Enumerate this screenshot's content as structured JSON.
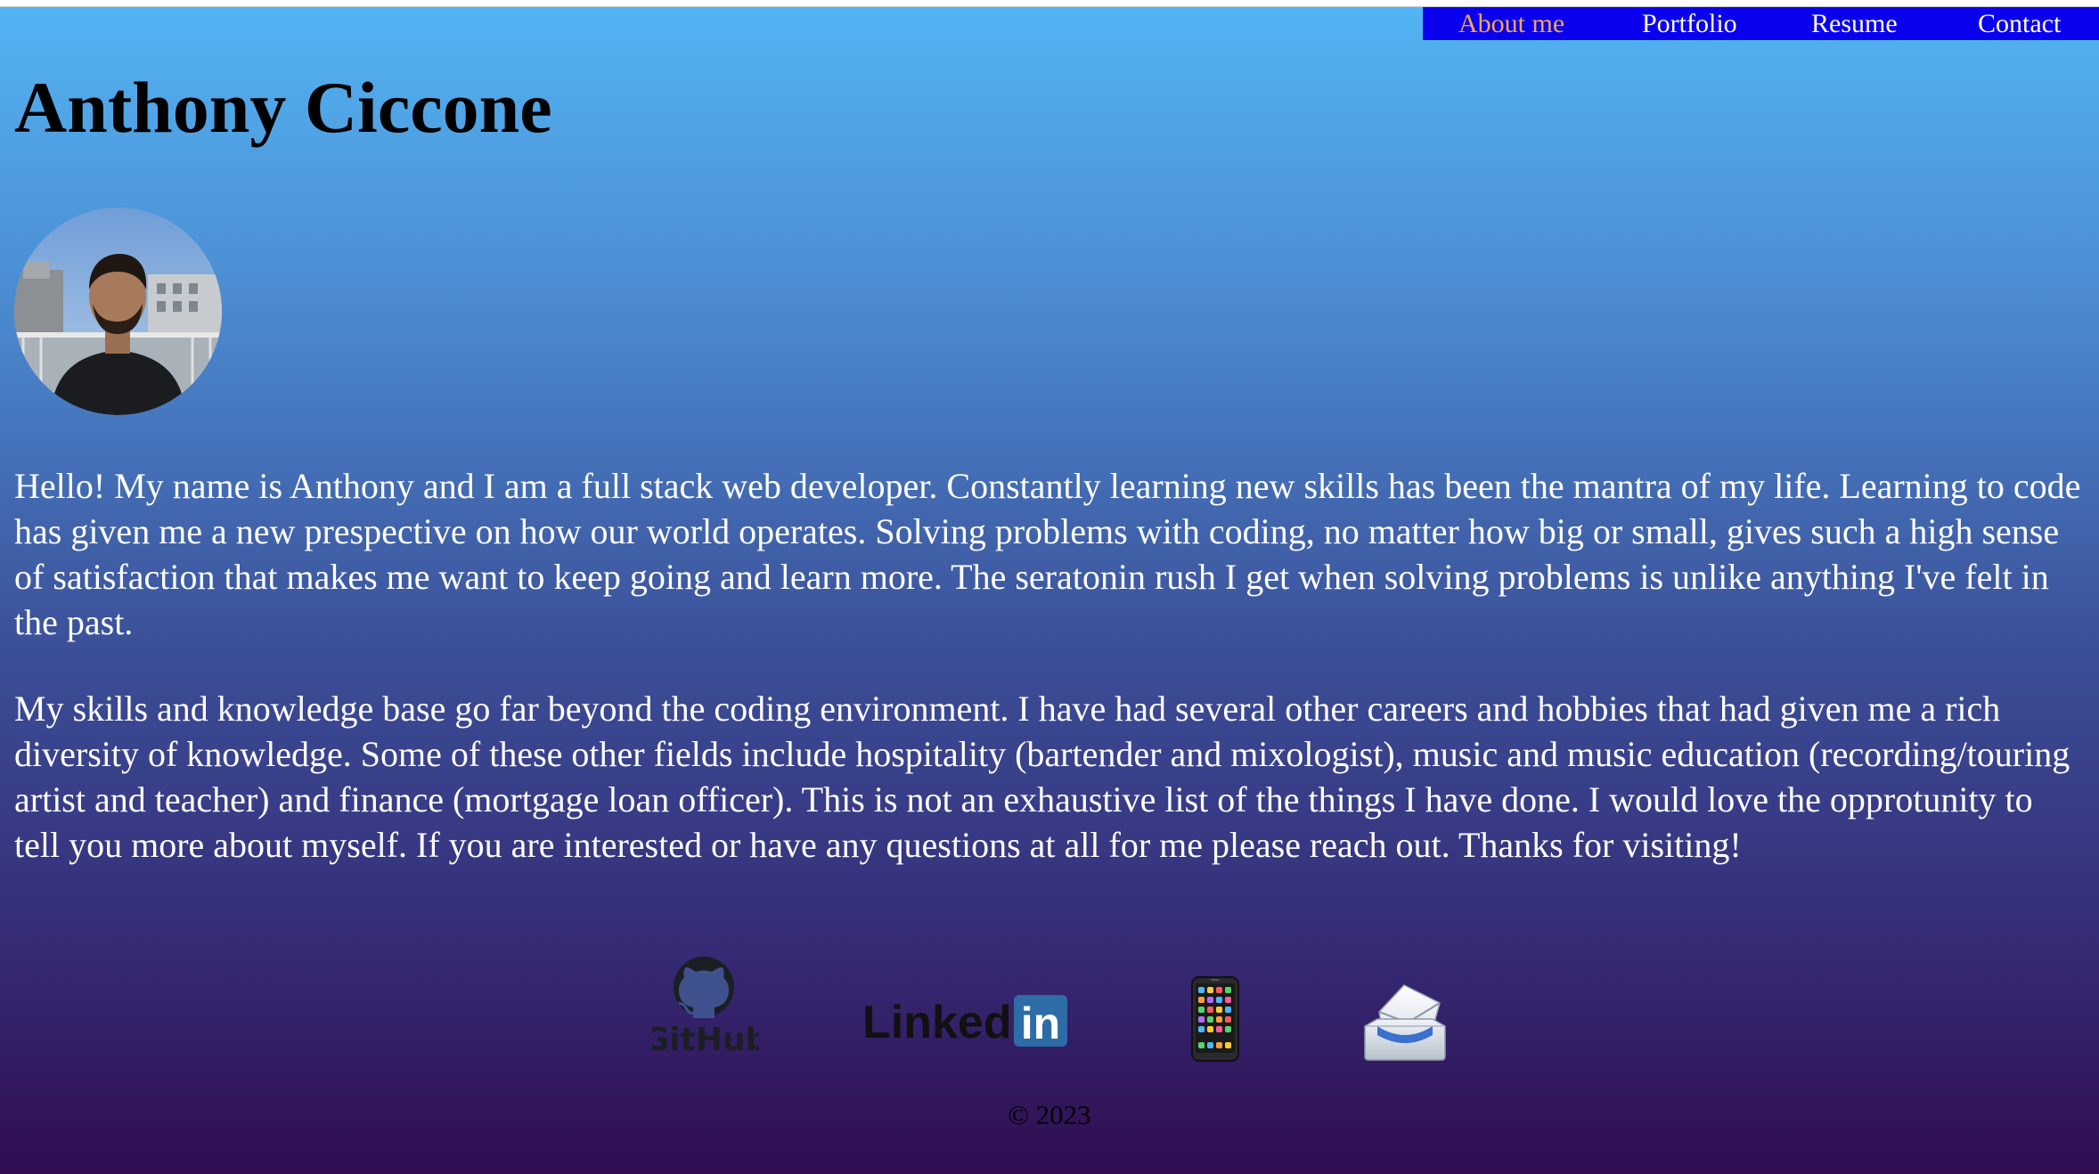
{
  "nav": {
    "items": [
      {
        "label": "About me",
        "active": true
      },
      {
        "label": "Portfolio",
        "active": false
      },
      {
        "label": "Resume",
        "active": false
      },
      {
        "label": "Contact",
        "active": false
      }
    ],
    "background": "#0a00ee",
    "active_color": "#f7a64c"
  },
  "header": {
    "title": "Anthony Ciccone"
  },
  "about": {
    "paragraphs": [
      "Hello! My name is Anthony and I am a full stack web developer. Constantly learning new skills has been the mantra of my life. Learning to code has given me a new prespective on how our world operates. Solving problems with coding, no matter how big or small, gives such a high sense of satisfaction that makes me want to keep going and learn more. The seratonin rush I get when solving problems is unlike anything I've felt in the past.",
      "My skills and knowledge base go far beyond the coding environment. I have had several other careers and hobbies that had given me a rich diversity of knowledge. Some of these other fields include hospitality (bartender and mixologist), music and music education (recording/touring artist and teacher) and finance (mortgage loan officer). This is not an exhaustive list of the things I have done. I would love the opprotunity to tell you more about myself. If you are interested or have any questions at all for me please reach out. Thanks for visiting!"
    ]
  },
  "links": {
    "github_logo_text": "GitHub",
    "linkedin_logo_text": "Linked",
    "linkedin_badge_text": "in",
    "icons": [
      "github-icon",
      "linkedin-icon",
      "phone-icon",
      "mail-icon"
    ]
  },
  "footer": {
    "copyright": "© 2023"
  },
  "colors": {
    "gradient_top": "#53b4f3",
    "gradient_bottom": "#300d50",
    "text": "#ffffff",
    "linkedin_blue": "#2d6ca6"
  }
}
